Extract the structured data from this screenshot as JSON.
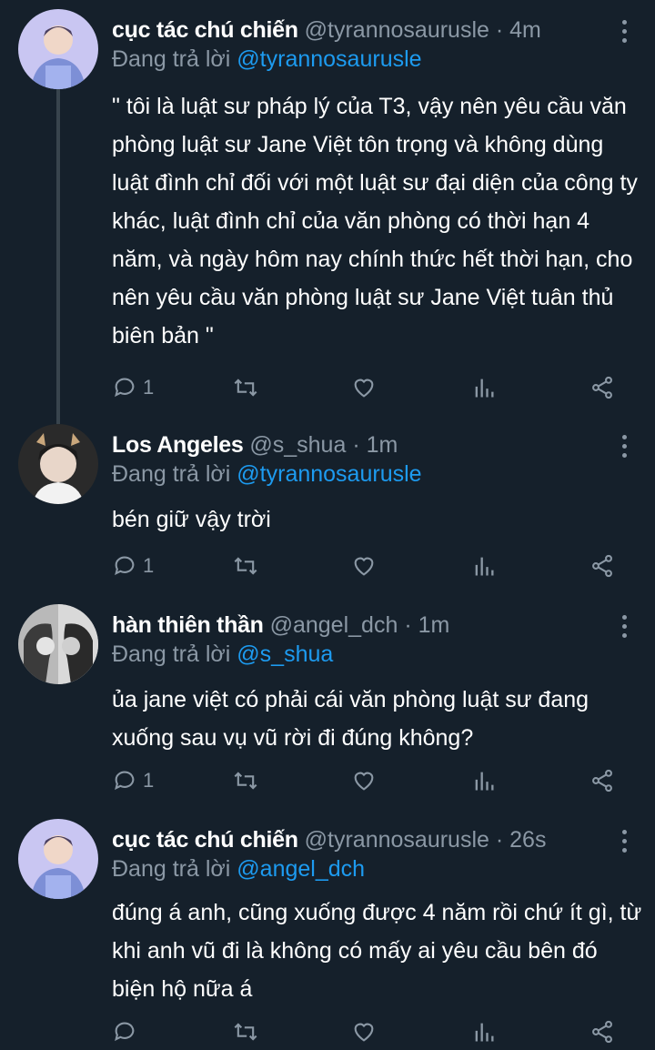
{
  "replying_label": "Đang trả lời",
  "tweets": [
    {
      "display_name": "cục tác chú chiến",
      "handle": "@tyrannosaurusle",
      "separator": "·",
      "time": "4m",
      "reply_to": "@tyrannosaurusle",
      "text": "\" tôi là luật sư pháp lý của T3, vậy nên yêu cầu văn phòng luật sư Jane Việt tôn trọng và không dùng luật đình chỉ đối với một luật sư đại diện của công ty khác, luật đình chỉ của văn phòng có thời hạn 4 năm, và ngày hôm nay chính thức hết thời hạn, cho nên yêu cầu văn phòng luật sư Jane Việt tuân thủ biên bản \"",
      "reply_count": "1"
    },
    {
      "display_name": "Los Angeles",
      "handle": "@s_shua",
      "separator": "·",
      "time": "1m",
      "reply_to": "@tyrannosaurusle",
      "text": "bén giữ vậy trời",
      "reply_count": "1"
    },
    {
      "display_name": "hàn thiên thần",
      "handle": "@angel_dch",
      "separator": "·",
      "time": "1m",
      "reply_to": "@s_shua",
      "text": "ủa jane việt có phải cái văn phòng luật sư đang xuống sau vụ vũ rời đi đúng không?",
      "reply_count": "1"
    },
    {
      "display_name": "cục tác chú chiến",
      "handle": "@tyrannosaurusle",
      "separator": "·",
      "time": "26s",
      "reply_to": "@angel_dch",
      "text": "đúng á anh, cũng xuống được 4 năm rồi chứ ít gì, từ khi anh vũ đi là không có mấy ai yêu cầu bên đó biện hộ nữa á",
      "reply_count": ""
    }
  ],
  "icons": {
    "reply": "reply-icon",
    "retweet": "retweet-icon",
    "like": "heart-icon",
    "views": "views-icon",
    "share": "share-icon",
    "more": "more-vertical-icon"
  },
  "colors": {
    "background": "#15202b",
    "secondary_text": "#8b98a5",
    "mention": "#1d9bf0",
    "thread_line": "#38444d"
  }
}
